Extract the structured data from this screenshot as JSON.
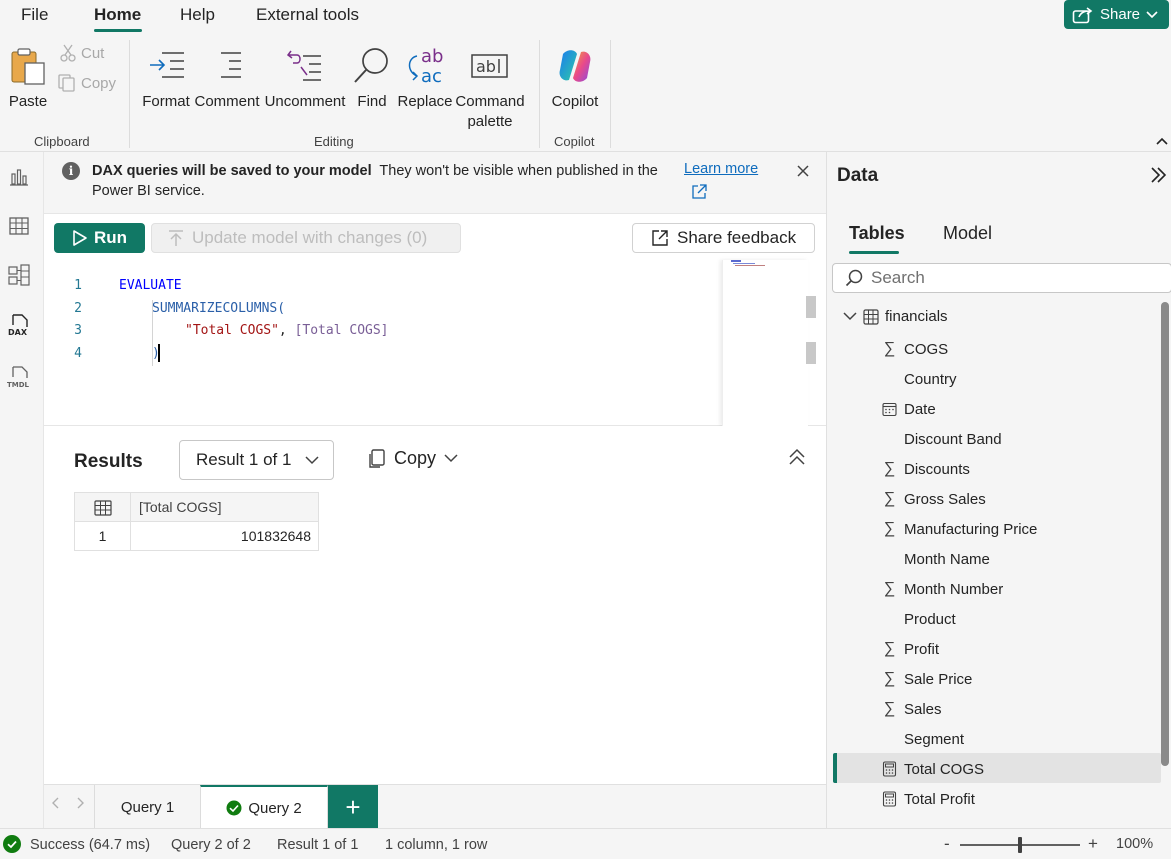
{
  "menu": {
    "file": "File",
    "home": "Home",
    "help": "Help",
    "external_tools": "External tools",
    "share": "Share"
  },
  "ribbon": {
    "paste": "Paste",
    "cut": "Cut",
    "copy": "Copy",
    "clipboard_group": "Clipboard",
    "format": "Format",
    "comment": "Comment",
    "uncomment": "Uncomment",
    "find": "Find",
    "replace": "Replace",
    "command_palette_1": "Command",
    "command_palette_2": "palette",
    "editing_group": "Editing",
    "copilot": "Copilot",
    "copilot_group": "Copilot"
  },
  "rail": {
    "icons": [
      "report-view-icon",
      "table-view-icon",
      "model-view-icon",
      "dax-query-view-icon",
      "tmdl-view-icon"
    ],
    "dax_label": "DAX",
    "tmdl_label": "TMDL"
  },
  "banner": {
    "bold": "DAX queries will be saved to your model",
    "text": "They won't be visible when published in the Power BI service.",
    "learn_more": "Learn more"
  },
  "toolbar": {
    "run": "Run",
    "update": "Update model with changes (0)",
    "feedback": "Share feedback"
  },
  "editor": {
    "line_numbers": [
      "1",
      "2",
      "3",
      "4"
    ],
    "line1": "EVALUATE",
    "line2_fn": "SUMMARIZECOLUMNS",
    "line2_paren": "(",
    "line3_str": "\"Total COGS\"",
    "line3_comma": ", ",
    "line3_meas": "[Total COGS]",
    "line4": ")"
  },
  "results": {
    "title": "Results",
    "result_select": "Result 1 of 1",
    "copy": "Copy",
    "column_header": "[Total COGS]",
    "rows": [
      {
        "row": "1",
        "value": "101832648"
      }
    ]
  },
  "query_tabs": {
    "tabs": [
      "Query 1",
      "Query 2"
    ],
    "active": "Query 2",
    "add": "+"
  },
  "data_pane": {
    "title": "Data",
    "tab_tables": "Tables",
    "tab_model": "Model",
    "search_placeholder": "Search",
    "table_name": "financials",
    "fields": [
      {
        "name": "COGS",
        "icon": "sigma"
      },
      {
        "name": "Country",
        "icon": "none"
      },
      {
        "name": "Date",
        "icon": "calendar"
      },
      {
        "name": "Discount Band",
        "icon": "none"
      },
      {
        "name": "Discounts",
        "icon": "sigma"
      },
      {
        "name": "Gross Sales",
        "icon": "sigma"
      },
      {
        "name": "Manufacturing Price",
        "icon": "sigma"
      },
      {
        "name": "Month Name",
        "icon": "none"
      },
      {
        "name": "Month Number",
        "icon": "sigma"
      },
      {
        "name": "Product",
        "icon": "none"
      },
      {
        "name": "Profit",
        "icon": "sigma"
      },
      {
        "name": "Sale Price",
        "icon": "sigma"
      },
      {
        "name": "Sales",
        "icon": "sigma"
      },
      {
        "name": "Segment",
        "icon": "none"
      },
      {
        "name": "Total COGS",
        "icon": "calculator"
      },
      {
        "name": "Total Profit",
        "icon": "calculator"
      }
    ],
    "selected_field": "Total COGS"
  },
  "status": {
    "success": "Success (64.7 ms)",
    "query": "Query 2 of 2",
    "result": "Result 1 of 1",
    "shape": "1 column, 1 row",
    "zoom_minus": "-",
    "zoom_plus": "+",
    "zoom": "100%"
  },
  "colors": {
    "accent": "#117865",
    "success": "#107c10",
    "link": "#0f6cbd"
  }
}
